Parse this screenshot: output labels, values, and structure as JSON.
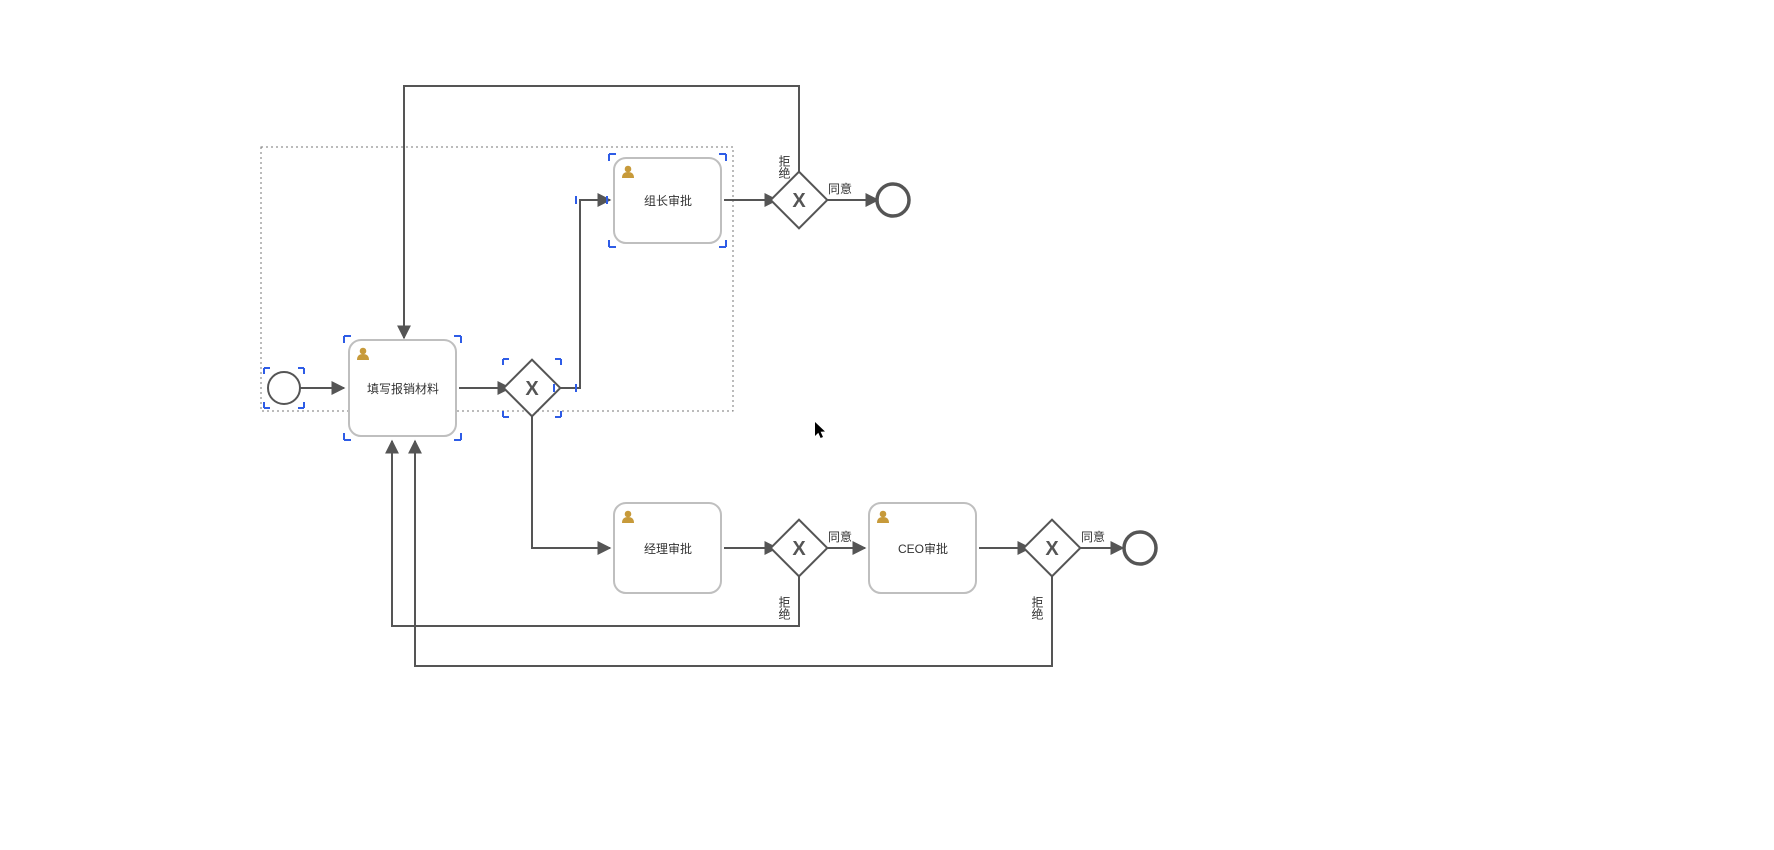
{
  "diagram": {
    "type": "bpmn-process",
    "tasks": {
      "fill_form": {
        "label": "填写报销材料"
      },
      "team_lead_review": {
        "label": "组长审批"
      },
      "manager_review": {
        "label": "经理审批"
      },
      "ceo_review": {
        "label": "CEO审批"
      }
    },
    "gateways": {
      "g1_after_team_lead": {
        "approve_label": "同意",
        "reject_label": "拒绝"
      },
      "g2_after_manager": {
        "approve_label": "同意",
        "reject_label": "拒绝"
      },
      "g3_after_ceo": {
        "approve_label": "同意",
        "reject_label": "拒绝"
      }
    },
    "colors": {
      "stroke": "#555555",
      "task_border": "#bfbfbf",
      "task_fill": "#ffffff",
      "selection": "#2e5ce6",
      "user_icon": "#c79a3a",
      "end_stroke": "#555555"
    }
  }
}
